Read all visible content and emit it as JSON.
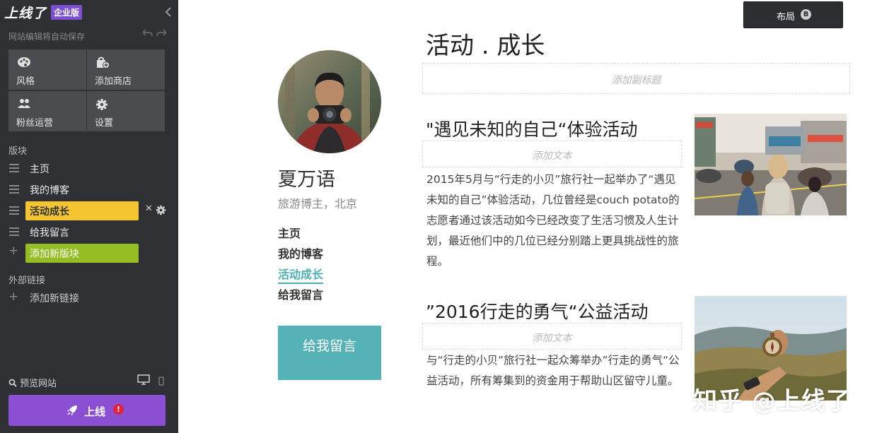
{
  "brand": {
    "logo": "上线了",
    "badge": "企业版"
  },
  "sidebar": {
    "autosave": "网站编辑将自动保存",
    "tiles": [
      {
        "label": "风格",
        "icon": "palette-icon"
      },
      {
        "label": "添加商店",
        "icon": "store-bag-icon"
      },
      {
        "label": "粉丝运营",
        "icon": "users-icon"
      },
      {
        "label": "设置",
        "icon": "gear-icon"
      }
    ],
    "sections_title": "版块",
    "sections": [
      {
        "label": "主页",
        "active": false
      },
      {
        "label": "我的博客",
        "active": false
      },
      {
        "label": "活动成长",
        "active": true
      },
      {
        "label": "给我留言",
        "active": false
      }
    ],
    "add_section": "添加新版块",
    "external_title": "外部链接",
    "add_link": "添加新链接",
    "preview": "预览网站",
    "publish": "上线",
    "publish_alert": "!",
    "colors": {
      "bg": "#2f3033",
      "active": "#f4c531",
      "add": "#93bd22",
      "publish": "#8b4fd3"
    }
  },
  "toolbar": {
    "layout_label": "布局",
    "layout_badge": "B"
  },
  "profile": {
    "name": "夏万语",
    "subtitle": "旅游博主，北京",
    "nav": [
      {
        "label": "主页",
        "active": false
      },
      {
        "label": "我的博客",
        "active": false
      },
      {
        "label": "活动成长",
        "active": true
      },
      {
        "label": "给我留言",
        "active": false
      }
    ],
    "message_button": "给我留言"
  },
  "main": {
    "title": "活动 . 成长",
    "subtitle_placeholder": "添加副标题",
    "posts": [
      {
        "title": "\"遇见未知的自己“体验活动",
        "text_placeholder": "添加文本",
        "body": "2015年5月与“行走的小贝”旅行社一起举办了“遇见未知的自己”体验活动，几位曾经是couch potato的志愿者通过该活动如今已经改变了生活习惯及人生计划，最近他们中的几位已经分别踏上更具挑战性的旅程。"
      },
      {
        "title": "”2016行走的勇气“公益活动",
        "text_placeholder": "添加文本",
        "body": "与“行走的小贝”旅行社一起众筹举办”行走的勇气“公益活动，所有筹集到的资金用于帮助山区留守儿童。"
      }
    ]
  },
  "watermark": "知乎 @上线了"
}
